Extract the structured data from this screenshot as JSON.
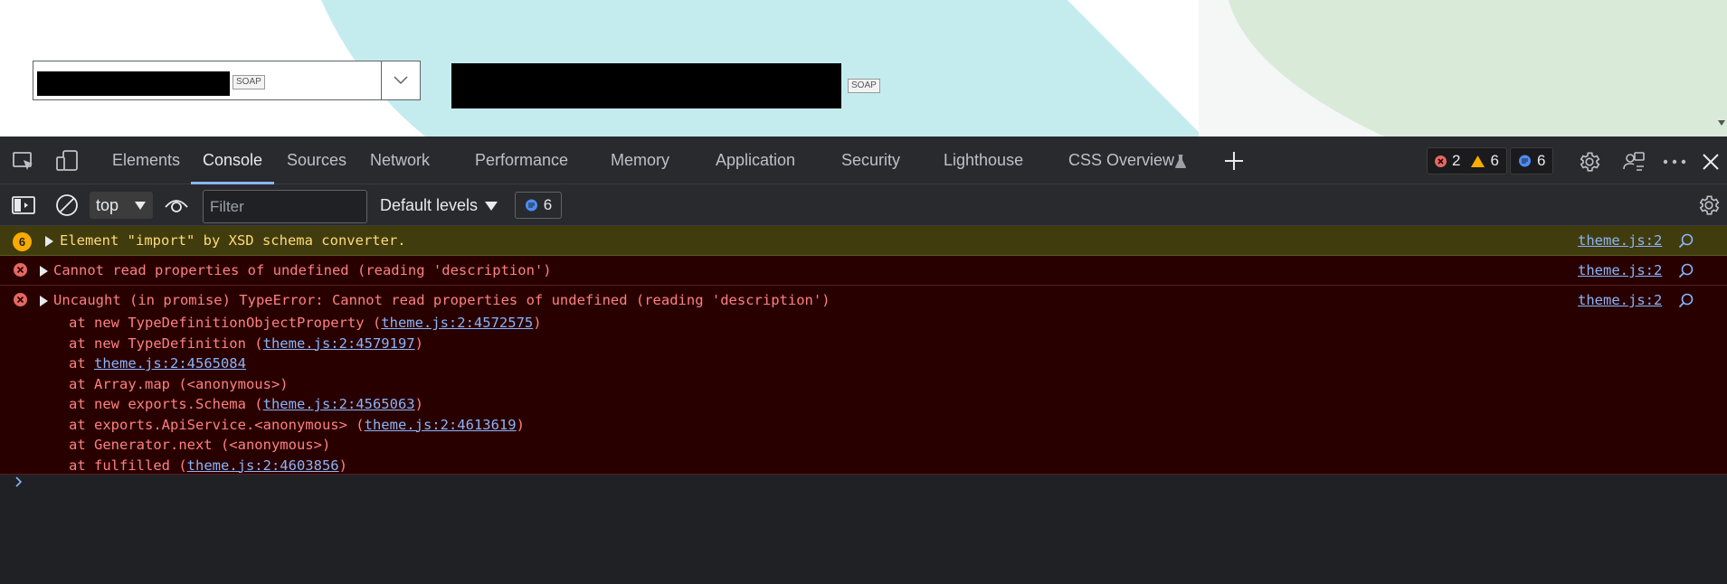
{
  "webpage": {
    "left_field_badge": "SOAP",
    "right_field_badge": "SOAP"
  },
  "devtools": {
    "tabs": [
      {
        "label": "Elements"
      },
      {
        "label": "Console"
      },
      {
        "label": "Sources"
      },
      {
        "label": "Network"
      },
      {
        "label": "Performance"
      },
      {
        "label": "Memory"
      },
      {
        "label": "Application"
      },
      {
        "label": "Security"
      },
      {
        "label": "Lighthouse"
      },
      {
        "label": "CSS Overview"
      }
    ],
    "active_tab": "Console",
    "counters": {
      "errors": "2",
      "warnings": "6",
      "messages": "6"
    },
    "toolbar": {
      "context": "top",
      "filter_placeholder": "Filter",
      "levels": "Default levels",
      "message_count": "6"
    },
    "console": {
      "warning": {
        "repeat_count": "6",
        "text": "Element \"import\" by XSD schema converter.",
        "source": "theme.js:2"
      },
      "error1": {
        "text": "Cannot read properties of undefined (reading 'description')",
        "source": "theme.js:2"
      },
      "error2": {
        "text": "Uncaught (in promise) TypeError: Cannot read properties of undefined (reading 'description')",
        "source": "theme.js:2",
        "stack": [
          {
            "pre": "at new TypeDefinitionObjectProperty (",
            "link": "theme.js:2:4572575",
            "post": ")"
          },
          {
            "pre": "at new TypeDefinition (",
            "link": "theme.js:2:4579197",
            "post": ")"
          },
          {
            "pre": "at ",
            "link": "theme.js:2:4565084",
            "post": ""
          },
          {
            "pre": "at Array.map (<anonymous>)",
            "link": "",
            "post": ""
          },
          {
            "pre": "at new exports.Schema (",
            "link": "theme.js:2:4565063",
            "post": ")"
          },
          {
            "pre": "at exports.ApiService.<anonymous> (",
            "link": "theme.js:2:4613619",
            "post": ")"
          },
          {
            "pre": "at Generator.next (<anonymous>)",
            "link": "",
            "post": ""
          },
          {
            "pre": "at fulfilled (",
            "link": "theme.js:2:4603856",
            "post": ")"
          }
        ]
      }
    },
    "colors": {
      "panel_bg": "#202124",
      "toolbar_bg": "#292a2d",
      "warning_bg": "#413c0d",
      "error_bg": "#290000",
      "error_text": "#ff8080",
      "warning_text": "#fddb7a",
      "link": "#8ab4f8",
      "accent": "#8ab4f8"
    }
  }
}
